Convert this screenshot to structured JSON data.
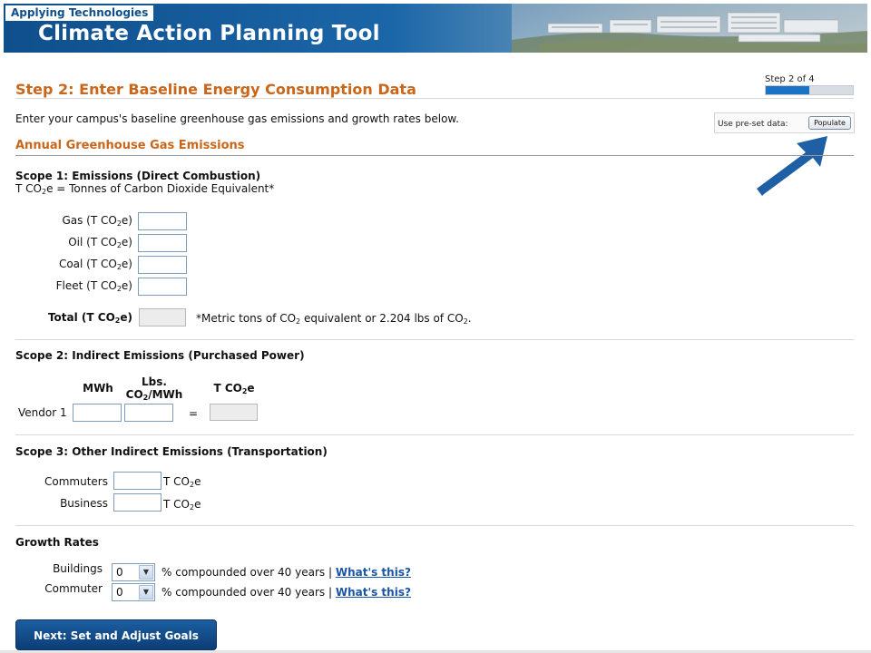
{
  "header": {
    "tag": "Applying Technologies",
    "title": "Climate Action Planning Tool"
  },
  "step": {
    "title": "Step 2: Enter Baseline Energy Consumption Data",
    "indicator": "Step 2 of 4",
    "progress_fraction": 0.5,
    "intro": "Enter your campus's baseline greenhouse gas emissions and growth rates below."
  },
  "preset": {
    "label": "Use pre-set data:",
    "button": "Populate"
  },
  "section": {
    "title": "Annual Greenhouse Gas Emissions"
  },
  "scope1": {
    "title": "Scope 1: Emissions (Direct Combustion)",
    "note_pre": "T CO",
    "note_sub": "2",
    "note_post": "e = Tonnes of Carbon Dioxide Equivalent*",
    "rows": [
      {
        "name": "Gas",
        "unit_pre": " (T CO",
        "unit_sub": "2",
        "unit_post": "e)",
        "value": ""
      },
      {
        "name": "Oil",
        "unit_pre": " (T CO",
        "unit_sub": "2",
        "unit_post": "e)",
        "value": ""
      },
      {
        "name": "Coal",
        "unit_pre": " (T CO",
        "unit_sub": "2",
        "unit_post": "e)",
        "value": ""
      },
      {
        "name": "Fleet",
        "unit_pre": " (T CO",
        "unit_sub": "2",
        "unit_post": "e)",
        "value": ""
      }
    ],
    "total_pre": "Total (T CO",
    "total_sub": "2",
    "total_post": "e)",
    "total_value": "",
    "footnote": {
      "p1": "*Metric tons of CO",
      "s1": "2",
      "p2": " equivalent or 2.204 lbs of CO",
      "s2": "2",
      "p3": "."
    }
  },
  "scope2": {
    "title": "Scope 2: Indirect Emissions (Purchased Power)",
    "col_mwh": "MWh",
    "col_lbs_1": "Lbs.",
    "col_lbs_2a": "CO",
    "col_lbs_2sub": "2",
    "col_lbs_2b": "/MWh",
    "col_t_pre": "T CO",
    "col_t_sub": "2",
    "col_t_post": "e",
    "vendor_label": "Vendor 1",
    "equals": "=",
    "mwh_value": "",
    "lbs_value": "",
    "result_value": ""
  },
  "scope3": {
    "title": "Scope 3: Other Indirect Emissions (Transportation)",
    "rows": [
      {
        "name": "Commuters",
        "value": "",
        "unit_pre": "T CO",
        "unit_sub": "2",
        "unit_post": "e"
      },
      {
        "name": "Business",
        "value": "",
        "unit_pre": "T CO",
        "unit_sub": "2",
        "unit_post": "e"
      }
    ]
  },
  "growth": {
    "title": "Growth Rates",
    "rows": [
      {
        "name": "Buildings",
        "value": "0",
        "text": "% compounded over 40 years |",
        "link": "What's this?"
      },
      {
        "name": "Commuter",
        "value": "0",
        "text": "% compounded over 40 years |",
        "link": "What's this?"
      }
    ]
  },
  "next_button": "Next: Set and Adjust Goals",
  "colors": {
    "accent_orange": "#c9661a",
    "brand_blue": "#0f4f8c",
    "link_blue": "#1a56a8",
    "arrow_blue": "#1f5fa6"
  }
}
